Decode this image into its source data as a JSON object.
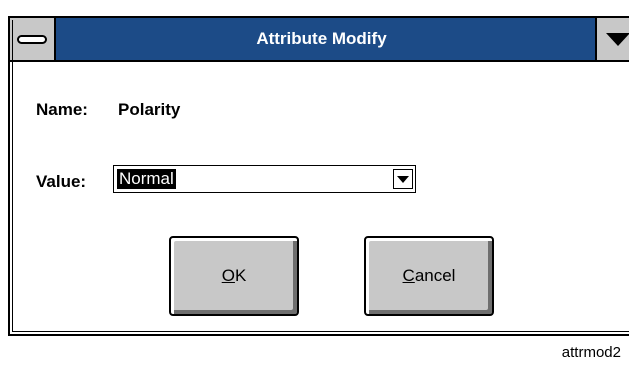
{
  "window": {
    "title": "Attribute Modify",
    "titlebar_color": "#1c4b87"
  },
  "system_menu_icon": "system-menu-bar-icon",
  "window_menu_icon": "dropdown-triangle-icon",
  "form": {
    "name_label": "Name:",
    "name_value": "Polarity",
    "value_label": "Value:",
    "value_selected": "Normal"
  },
  "buttons": {
    "ok_mnemonic": "O",
    "ok_rest": "K",
    "cancel_mnemonic": "C",
    "cancel_rest": "ancel"
  },
  "caption": "attrmod2"
}
